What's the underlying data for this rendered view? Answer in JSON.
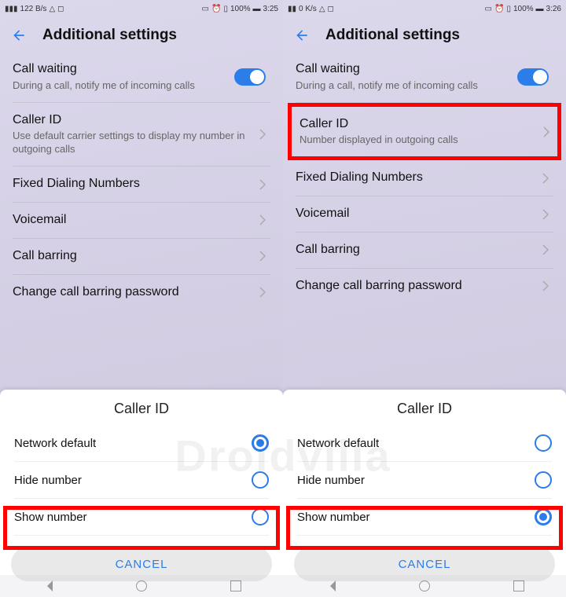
{
  "watermark": "Droidvilla",
  "left": {
    "statusbar": {
      "net": "3G 4G",
      "speed": "122 B/s",
      "battery": "100%",
      "time": "3:25"
    },
    "header": {
      "title": "Additional settings"
    },
    "items": {
      "call_waiting": {
        "title": "Call waiting",
        "sub": "During a call, notify me of incoming calls"
      },
      "caller_id": {
        "title": "Caller ID",
        "sub": "Use default carrier settings to display my number in outgoing calls"
      },
      "fdn": {
        "title": "Fixed Dialing Numbers"
      },
      "voicemail": {
        "title": "Voicemail"
      },
      "call_barring": {
        "title": "Call barring"
      },
      "change_pw": {
        "title": "Change call barring password"
      }
    },
    "sheet": {
      "title": "Caller ID",
      "options": {
        "net_default": "Network default",
        "hide": "Hide number",
        "show": "Show number"
      },
      "selected": "net_default",
      "highlighted": "show",
      "cancel": "CANCEL"
    }
  },
  "right": {
    "statusbar": {
      "net": "3G",
      "speed": "0 K/s",
      "battery": "100%",
      "time": "3:26"
    },
    "header": {
      "title": "Additional settings"
    },
    "items": {
      "call_waiting": {
        "title": "Call waiting",
        "sub": "During a call, notify me of incoming calls"
      },
      "caller_id": {
        "title": "Caller ID",
        "sub": "Number displayed in outgoing calls"
      },
      "fdn": {
        "title": "Fixed Dialing Numbers"
      },
      "voicemail": {
        "title": "Voicemail"
      },
      "call_barring": {
        "title": "Call barring"
      },
      "change_pw": {
        "title": "Change call barring password"
      }
    },
    "sheet": {
      "title": "Caller ID",
      "options": {
        "net_default": "Network default",
        "hide": "Hide number",
        "show": "Show number"
      },
      "selected": "show",
      "highlighted": "show",
      "cancel": "CANCEL"
    }
  }
}
